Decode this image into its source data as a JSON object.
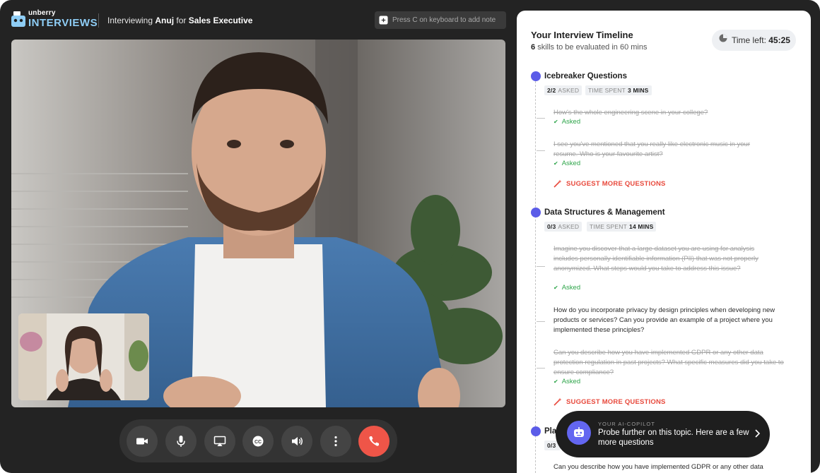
{
  "header": {
    "logo_top": "unberry",
    "logo_bottom": "INTERVIEWS",
    "prefix": "Interviewing",
    "candidate": "Anuj",
    "for_word": "for",
    "role": "Sales Executive",
    "note_hint": "Press C on keyboard to add note"
  },
  "panel": {
    "title": "Your Interview Timeline",
    "skills_count": "6",
    "skills_text": "skills to be evaluated in 60 mins",
    "timer_label": "Time left:",
    "timer_value": "45:25"
  },
  "sections": [
    {
      "title": "Icebreaker Questions",
      "asked_count": "2/2",
      "asked_label": "ASKED",
      "time_label": "TIME SPENT",
      "time_value": "3 MINS",
      "questions": [
        {
          "text": "How's the whole engineering scene in your college?",
          "status": "Asked"
        },
        {
          "text": "I see you've mentioned that you really like electronic music in your resume. Who is your favourite artist?",
          "status": "Asked"
        }
      ],
      "suggest": "SUGGEST MORE QUESTIONS"
    },
    {
      "title": "Data Structures & Management",
      "asked_count": "0/3",
      "asked_label": "ASKED",
      "time_label": "TIME SPENT",
      "time_value": "14 MINS",
      "questions": [
        {
          "text": "Imagine you discover that a large dataset you are using for analysis includes personally identifiable information (PII) that was not properly anonymized. What steps would you take to address this issue?",
          "status": "Asked"
        },
        {
          "text": "How do you incorporate privacy by design principles when developing new products or services? Can you provide an example of a project where you implemented these principles?",
          "status": ""
        },
        {
          "text": "Can you describe how you have implemented GDPR or any other data protection regulation in past projects? What specific measures did you take to ensure compliance?",
          "status": "Asked"
        }
      ],
      "suggest": "SUGGEST MORE QUESTIONS"
    },
    {
      "title_partial": "Pla",
      "asked_partial": "0/3",
      "question_partial": "Can you describe how you have implemented GDPR or any other data"
    }
  ],
  "copilot": {
    "label": "YOUR AI-COPILOT",
    "message": "Probe further on this topic. Here are a few more questions"
  },
  "controls": [
    "camera-icon",
    "microphone-icon",
    "screen-share-icon",
    "captions-icon",
    "speaker-icon",
    "more-options-icon",
    "end-call-icon"
  ],
  "colors": {
    "accent": "#5b5ce8",
    "asked": "#2ea54a",
    "suggest": "#e8493c",
    "end_call": "#ef5548",
    "logo": "#8ecdf5"
  }
}
